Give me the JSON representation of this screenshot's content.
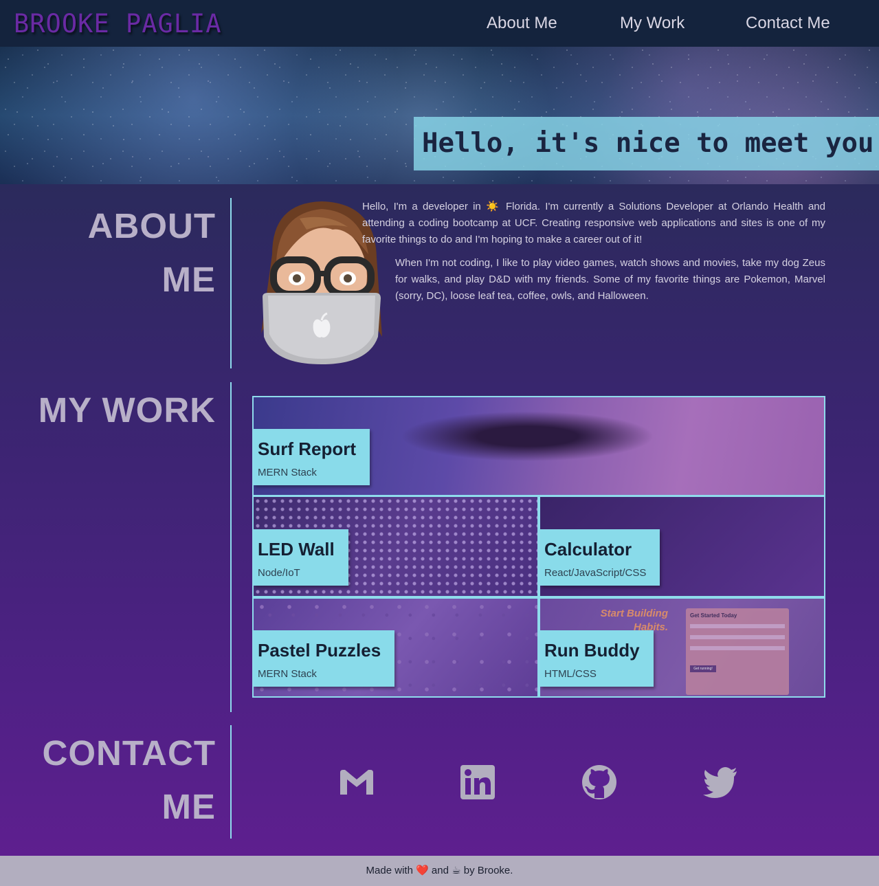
{
  "nav": {
    "brand": "BROOKE PAGLIA",
    "links": [
      "About Me",
      "My Work",
      "Contact Me"
    ]
  },
  "hero": {
    "greeting": "Hello, it's nice to meet you"
  },
  "about": {
    "title_line1": "ABOUT",
    "title_line2": "ME",
    "avatar_icon": "memoji-avatar-icon",
    "paragraph1": "Hello, I'm a developer in ☀️ Florida. I'm currently a Solutions Developer at Orlando Health and attending a coding bootcamp at UCF. Creating responsive web applications and sites is one of my favorite things to do and I'm hoping to make a career out of it!",
    "paragraph2": "When I'm not coding, I like to play video games, watch shows and movies, take my dog Zeus for walks, and play D&D with my friends. Some of my favorite things are Pokemon, Marvel (sorry, DC), loose leaf tea, coffee, owls, and Halloween."
  },
  "work": {
    "title": "MY WORK",
    "projects": [
      {
        "name": "Surf Report",
        "tech": "MERN Stack"
      },
      {
        "name": "LED Wall",
        "tech": "Node/IoT"
      },
      {
        "name": "Calculator",
        "tech": "React/JavaScript/CSS"
      },
      {
        "name": "Pastel Puzzles",
        "tech": "MERN Stack"
      },
      {
        "name": "Run Buddy",
        "tech": "HTML/CSS"
      }
    ],
    "run_buddy_preview": {
      "headline_1": "Start Building",
      "headline_2": "Habits.",
      "form_title": "Get Started Today",
      "button": "Get running!"
    }
  },
  "contact": {
    "title_line1": "CONTACT",
    "title_line2": "ME",
    "icons": [
      "gmail-icon",
      "linkedin-icon",
      "github-icon",
      "twitter-icon"
    ]
  },
  "footer": {
    "text": "Made with ❤️ and ☕ by Brooke."
  },
  "colors": {
    "accent": "#89dbea",
    "brand": "#6a2aa4",
    "nav_bg": "#14233d",
    "footer_bg": "#b2aebf"
  }
}
